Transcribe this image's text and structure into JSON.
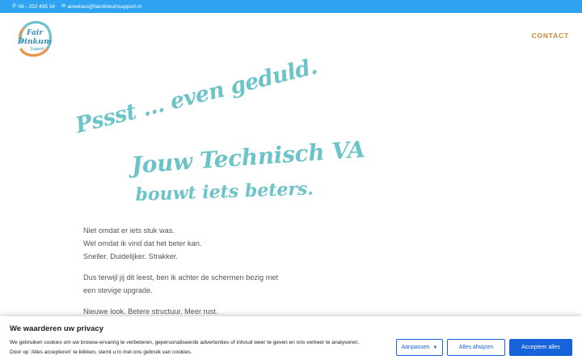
{
  "topbar": {
    "phone": "06 - 252 495 34",
    "phone_icon": "phone-icon",
    "email": "anneloes@fairdinkumsupport.nl",
    "email_icon": "envelope-icon"
  },
  "header": {
    "logo": {
      "line1": "Fair",
      "line2": "Dinkum",
      "line3": "Support"
    },
    "nav": {
      "contact": "CONTACT"
    }
  },
  "hero": {
    "line1": "Pssst ... even geduld.",
    "line2": "Jouw Technisch VA",
    "line3": "bouwt iets beters."
  },
  "content": {
    "p1": [
      "Niet omdat er iets stuk was.",
      "Wel omdat ik vind dat het beter kan.",
      "Sneller. Duidelijker. Strakker."
    ],
    "p2": [
      "Dus terwijl jij dit leest, ben ik achter de schermen bezig met",
      "een stevige upgrade."
    ],
    "p3": "Nieuwe look. Betere structuur. Meer rust."
  },
  "cookie": {
    "title": "We waarderen uw privacy",
    "text_line1": "We gebruiken cookies om uw browse-ervaring te verbeteren, gepersonaliseerde advertenties of inhoud weer te geven en ons verkeer te analyseren.",
    "text_line2": "Door op 'Alles accepteren' te klikken, stemt u in met ons gebruik van cookies.",
    "customize_label": "Aanpassen",
    "reject_label": "Alles afwijzen",
    "accept_label": "Accepteer alles"
  },
  "colors": {
    "topbar": "#2ea3f2",
    "accent_orange": "#c98636",
    "script_teal": "#6cc3c8",
    "button_blue": "#1863dc"
  }
}
